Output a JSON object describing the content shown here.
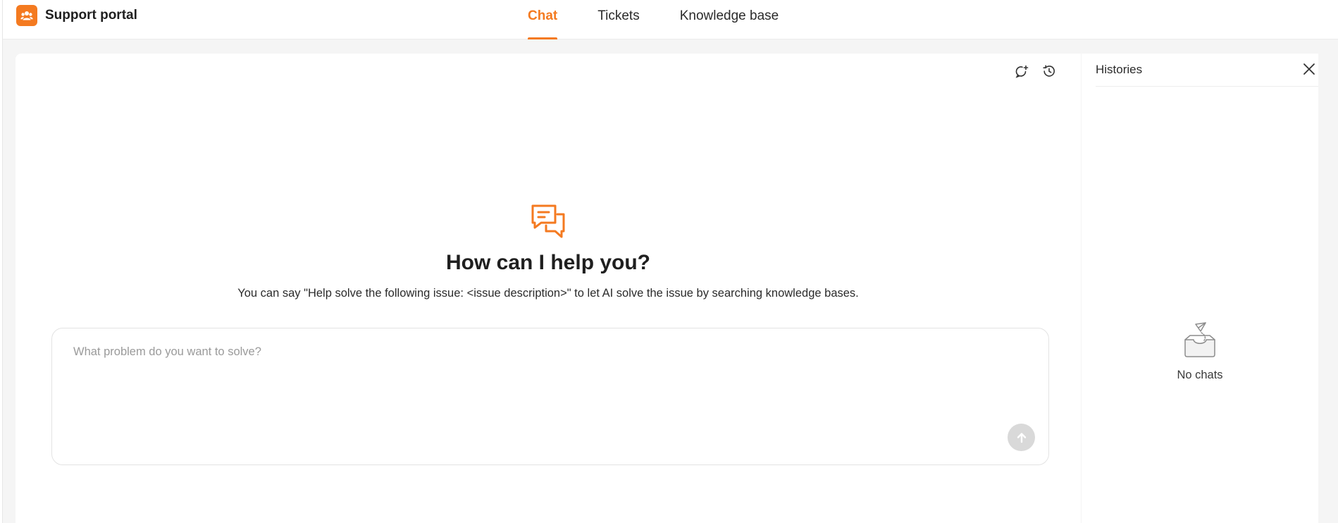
{
  "app": {
    "title": "Support portal"
  },
  "nav": {
    "tabs": [
      {
        "label": "Chat",
        "active": true
      },
      {
        "label": "Tickets",
        "active": false
      },
      {
        "label": "Knowledge base",
        "active": false
      }
    ]
  },
  "chat": {
    "tools": [
      {
        "icon": "new-chat-icon"
      },
      {
        "icon": "history-icon"
      }
    ],
    "hero": {
      "icon": "chat-bubbles-icon",
      "title": "How can I help you?",
      "subtitle": "You can say \"Help solve the following issue: <issue description>\" to let AI solve the issue by searching knowledge bases."
    },
    "composer": {
      "placeholder": "What problem do you want to solve?",
      "value": "",
      "send_icon": "arrow-up-icon"
    }
  },
  "histories": {
    "title": "Histories",
    "close_icon": "close-icon",
    "empty_icon": "empty-inbox-icon",
    "empty_text": "No chats"
  },
  "colors": {
    "accent": "#f47a20",
    "background": "#f5f5f5",
    "card": "#ffffff",
    "send_disabled": "#d9d9d9"
  }
}
